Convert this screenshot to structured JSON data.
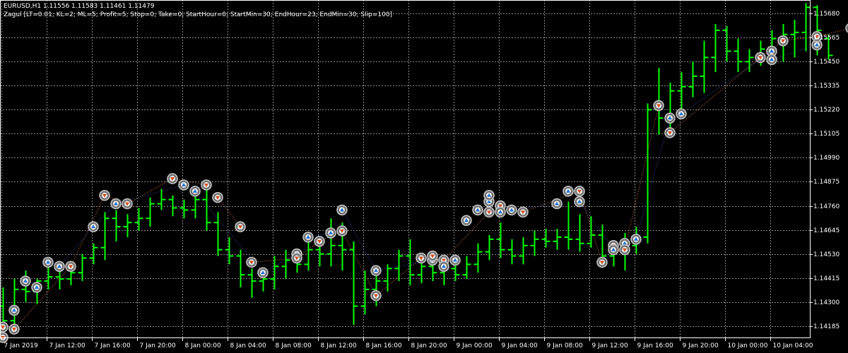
{
  "header": {
    "symbol_line": "EURUSD,H1  1.11556 1.11583 1.11461 1.11479",
    "indicator_line": "Zagul [LT=0.01; KL=2; ML=5; Profit=5; Stop=0; Take=0; StartHour=0; StartMin=30; EndHour=23; EndMin=30; Slip=100]"
  },
  "colors": {
    "background": "#000000",
    "grid": "#8a8a8a",
    "bar": "#00ff00",
    "text": "#ffffff",
    "buy_marker": "#1e6ed2",
    "sell_marker": "#d24b1e",
    "marker_ring": "#c8c8c8",
    "sell_link_line": "#e07030",
    "buy_link_line": "#2850b4"
  },
  "axes": {
    "price_labels": [
      "1.15680",
      "1.15565",
      "1.15450",
      "1.15335",
      "1.15220",
      "1.15105",
      "1.14990",
      "1.14875",
      "1.14760",
      "1.14645",
      "1.14530",
      "1.14415",
      "1.14300",
      "1.14185"
    ],
    "time_labels": [
      "7 Jan 2019",
      "7 Jan 12:00",
      "7 Jan 16:00",
      "7 Jan 20:00",
      "8 Jan 00:00",
      "8 Jan 04:00",
      "8 Jan 08:00",
      "8 Jan 12:00",
      "8 Jan 16:00",
      "8 Jan 20:00",
      "9 Jan 00:00",
      "9 Jan 04:00",
      "9 Jan 08:00",
      "9 Jan 12:00",
      "9 Jan 16:00",
      "9 Jan 20:00",
      "10 Jan 00:00",
      "10 Jan 04:00"
    ]
  },
  "chart_data": {
    "type": "ohlc",
    "ylim": [
      1.1413,
      1.15745
    ],
    "bars": [
      [
        1.1428,
        1.1437,
        1.1415,
        1.1421
      ],
      [
        1.1421,
        1.1441,
        1.1419,
        1.1436
      ],
      [
        1.1436,
        1.1445,
        1.143,
        1.1435
      ],
      [
        1.1435,
        1.1441,
        1.1429,
        1.144
      ],
      [
        1.144,
        1.1447,
        1.1436,
        1.1442
      ],
      [
        1.1442,
        1.1449,
        1.1436,
        1.1441
      ],
      [
        1.1441,
        1.1448,
        1.1438,
        1.1444
      ],
      [
        1.1444,
        1.1453,
        1.144,
        1.1451
      ],
      [
        1.1451,
        1.1458,
        1.1448,
        1.1456
      ],
      [
        1.1456,
        1.1473,
        1.145,
        1.147
      ],
      [
        1.147,
        1.1474,
        1.1459,
        1.1466
      ],
      [
        1.1466,
        1.1472,
        1.1461,
        1.1468
      ],
      [
        1.1468,
        1.1475,
        1.1464,
        1.147
      ],
      [
        1.147,
        1.148,
        1.1466,
        1.1477
      ],
      [
        1.1477,
        1.1484,
        1.1474,
        1.1479
      ],
      [
        1.1479,
        1.1481,
        1.1471,
        1.1475
      ],
      [
        1.1475,
        1.1479,
        1.147,
        1.1474
      ],
      [
        1.1474,
        1.1482,
        1.147,
        1.1479
      ],
      [
        1.1479,
        1.1485,
        1.1464,
        1.1468
      ],
      [
        1.1468,
        1.1473,
        1.1452,
        1.1455
      ],
      [
        1.1455,
        1.1461,
        1.1448,
        1.1452
      ],
      [
        1.1452,
        1.1455,
        1.1437,
        1.1443
      ],
      [
        1.1443,
        1.1446,
        1.1432,
        1.144
      ],
      [
        1.144,
        1.1443,
        1.1435,
        1.1441
      ],
      [
        1.1441,
        1.1452,
        1.1436,
        1.1447
      ],
      [
        1.1447,
        1.1455,
        1.1441,
        1.145
      ],
      [
        1.145,
        1.1455,
        1.1444,
        1.1448
      ],
      [
        1.1448,
        1.146,
        1.1445,
        1.1455
      ],
      [
        1.1455,
        1.146,
        1.1447,
        1.1453
      ],
      [
        1.1453,
        1.147,
        1.1447,
        1.1457
      ],
      [
        1.1457,
        1.1468,
        1.1445,
        1.1455
      ],
      [
        1.1455,
        1.1459,
        1.1419,
        1.1428
      ],
      [
        1.1428,
        1.1445,
        1.1424,
        1.1436
      ],
      [
        1.1436,
        1.1446,
        1.1428,
        1.144
      ],
      [
        1.144,
        1.1448,
        1.1435,
        1.1446
      ],
      [
        1.1446,
        1.1455,
        1.144,
        1.1452
      ],
      [
        1.1452,
        1.146,
        1.1438,
        1.1443
      ],
      [
        1.1443,
        1.1452,
        1.1439,
        1.1447
      ],
      [
        1.1447,
        1.1452,
        1.144,
        1.1444
      ],
      [
        1.1444,
        1.1451,
        1.1438,
        1.1446
      ],
      [
        1.1446,
        1.145,
        1.144,
        1.1443
      ],
      [
        1.1443,
        1.1452,
        1.1441,
        1.1448
      ],
      [
        1.1448,
        1.1458,
        1.1444,
        1.1454
      ],
      [
        1.1454,
        1.1462,
        1.145,
        1.146
      ],
      [
        1.146,
        1.1468,
        1.1451,
        1.1455
      ],
      [
        1.1455,
        1.146,
        1.1448,
        1.1452
      ],
      [
        1.1452,
        1.1461,
        1.1448,
        1.1457
      ],
      [
        1.1457,
        1.1464,
        1.1452,
        1.146
      ],
      [
        1.146,
        1.1465,
        1.1456,
        1.1459
      ],
      [
        1.1459,
        1.1465,
        1.1455,
        1.1461
      ],
      [
        1.1461,
        1.1478,
        1.1455,
        1.146
      ],
      [
        1.146,
        1.1472,
        1.1454,
        1.1458
      ],
      [
        1.1458,
        1.1471,
        1.1456,
        1.1462
      ],
      [
        1.1462,
        1.1467,
        1.145,
        1.1452
      ],
      [
        1.1452,
        1.1458,
        1.1447,
        1.1455
      ],
      [
        1.1455,
        1.1463,
        1.1445,
        1.1457
      ],
      [
        1.1457,
        1.1466,
        1.1453,
        1.1461
      ],
      [
        1.1461,
        1.1525,
        1.1458,
        1.1522
      ],
      [
        1.1522,
        1.1542,
        1.151,
        1.1518
      ],
      [
        1.1518,
        1.1535,
        1.1512,
        1.1531
      ],
      [
        1.1531,
        1.154,
        1.152,
        1.1533
      ],
      [
        1.1533,
        1.1545,
        1.1528,
        1.1538
      ],
      [
        1.1538,
        1.1555,
        1.153,
        1.1547
      ],
      [
        1.1547,
        1.1563,
        1.154,
        1.156
      ],
      [
        1.156,
        1.1562,
        1.1545,
        1.155
      ],
      [
        1.155,
        1.1556,
        1.154,
        1.1545
      ],
      [
        1.1545,
        1.1551,
        1.154,
        1.1547
      ],
      [
        1.1547,
        1.1555,
        1.1543,
        1.1551
      ],
      [
        1.1551,
        1.156,
        1.1546,
        1.1556
      ],
      [
        1.1556,
        1.1563,
        1.1545,
        1.1558
      ],
      [
        1.1558,
        1.1565,
        1.1547,
        1.1559
      ],
      [
        1.1559,
        1.1573,
        1.155,
        1.1571
      ],
      [
        1.1571,
        1.1572,
        1.1548,
        1.156
      ],
      [
        1.1556,
        1.1558,
        1.1546,
        1.1548
      ]
    ],
    "markers": [
      {
        "bar": 0,
        "price": 1.1418,
        "side": "sell"
      },
      {
        "bar": 0,
        "price": 1.1413,
        "side": "sell"
      },
      {
        "bar": 1,
        "price": 1.1426,
        "side": "buy"
      },
      {
        "bar": 1,
        "price": 1.1417,
        "side": "sell"
      },
      {
        "bar": 2,
        "price": 1.144,
        "side": "buy"
      },
      {
        "bar": 3,
        "price": 1.1437,
        "side": "buy"
      },
      {
        "bar": 4,
        "price": 1.1449,
        "side": "buy"
      },
      {
        "bar": 5,
        "price": 1.1447,
        "side": "buy"
      },
      {
        "bar": 6,
        "price": 1.1447,
        "side": "sell"
      },
      {
        "bar": 8,
        "price": 1.1466,
        "side": "buy"
      },
      {
        "bar": 9,
        "price": 1.1481,
        "side": "sell"
      },
      {
        "bar": 10,
        "price": 1.1477,
        "side": "buy"
      },
      {
        "bar": 11,
        "price": 1.1477,
        "side": "sell"
      },
      {
        "bar": 15,
        "price": 1.1489,
        "side": "sell"
      },
      {
        "bar": 16,
        "price": 1.1486,
        "side": "buy"
      },
      {
        "bar": 17,
        "price": 1.1483,
        "side": "buy"
      },
      {
        "bar": 18,
        "price": 1.1486,
        "side": "sell"
      },
      {
        "bar": 19,
        "price": 1.148,
        "side": "sell"
      },
      {
        "bar": 21,
        "price": 1.1466,
        "side": "sell"
      },
      {
        "bar": 22,
        "price": 1.1449,
        "side": "sell"
      },
      {
        "bar": 23,
        "price": 1.1444,
        "side": "buy"
      },
      {
        "bar": 26,
        "price": 1.1453,
        "side": "buy"
      },
      {
        "bar": 26,
        "price": 1.1451,
        "side": "sell"
      },
      {
        "bar": 27,
        "price": 1.1461,
        "side": "buy"
      },
      {
        "bar": 28,
        "price": 1.1459,
        "side": "sell"
      },
      {
        "bar": 29,
        "price": 1.1463,
        "side": "buy"
      },
      {
        "bar": 30,
        "price": 1.1464,
        "side": "sell"
      },
      {
        "bar": 30,
        "price": 1.1474,
        "side": "buy"
      },
      {
        "bar": 33,
        "price": 1.1445,
        "side": "buy"
      },
      {
        "bar": 33,
        "price": 1.1433,
        "side": "sell"
      },
      {
        "bar": 37,
        "price": 1.1451,
        "side": "sell"
      },
      {
        "bar": 38,
        "price": 1.145,
        "side": "buy"
      },
      {
        "bar": 38,
        "price": 1.1452,
        "side": "sell"
      },
      {
        "bar": 39,
        "price": 1.145,
        "side": "sell"
      },
      {
        "bar": 39,
        "price": 1.1447,
        "side": "buy"
      },
      {
        "bar": 40,
        "price": 1.145,
        "side": "buy"
      },
      {
        "bar": 41,
        "price": 1.1469,
        "side": "buy"
      },
      {
        "bar": 42,
        "price": 1.1474,
        "side": "buy"
      },
      {
        "bar": 43,
        "price": 1.1478,
        "side": "buy"
      },
      {
        "bar": 43,
        "price": 1.1473,
        "side": "sell"
      },
      {
        "bar": 43,
        "price": 1.1481,
        "side": "buy"
      },
      {
        "bar": 44,
        "price": 1.1476,
        "side": "sell"
      },
      {
        "bar": 44,
        "price": 1.1473,
        "side": "buy"
      },
      {
        "bar": 45,
        "price": 1.1474,
        "side": "buy"
      },
      {
        "bar": 46,
        "price": 1.1473,
        "side": "sell"
      },
      {
        "bar": 49,
        "price": 1.1477,
        "side": "buy"
      },
      {
        "bar": 50,
        "price": 1.1483,
        "side": "buy"
      },
      {
        "bar": 51,
        "price": 1.1478,
        "side": "buy"
      },
      {
        "bar": 51,
        "price": 1.1483,
        "side": "sell"
      },
      {
        "bar": 53,
        "price": 1.1449,
        "side": "sell"
      },
      {
        "bar": 54,
        "price": 1.1457,
        "side": "sell"
      },
      {
        "bar": 54,
        "price": 1.1455,
        "side": "buy"
      },
      {
        "bar": 55,
        "price": 1.1458,
        "side": "buy"
      },
      {
        "bar": 55,
        "price": 1.1455,
        "side": "sell"
      },
      {
        "bar": 56,
        "price": 1.146,
        "side": "buy"
      },
      {
        "bar": 58,
        "price": 1.1524,
        "side": "sell"
      },
      {
        "bar": 59,
        "price": 1.1518,
        "side": "buy"
      },
      {
        "bar": 59,
        "price": 1.1511,
        "side": "sell"
      },
      {
        "bar": 60,
        "price": 1.152,
        "side": "buy"
      },
      {
        "bar": 67,
        "price": 1.1547,
        "side": "sell"
      },
      {
        "bar": 68,
        "price": 1.155,
        "side": "buy"
      },
      {
        "bar": 68,
        "price": 1.1546,
        "side": "buy"
      },
      {
        "bar": 69,
        "price": 1.1555,
        "side": "sell"
      },
      {
        "bar": 72,
        "price": 1.1553,
        "side": "buy"
      },
      {
        "bar": 72,
        "price": 1.1557,
        "side": "sell"
      },
      {
        "bar": 75,
        "price": 1.1561,
        "side": "sell"
      }
    ]
  }
}
